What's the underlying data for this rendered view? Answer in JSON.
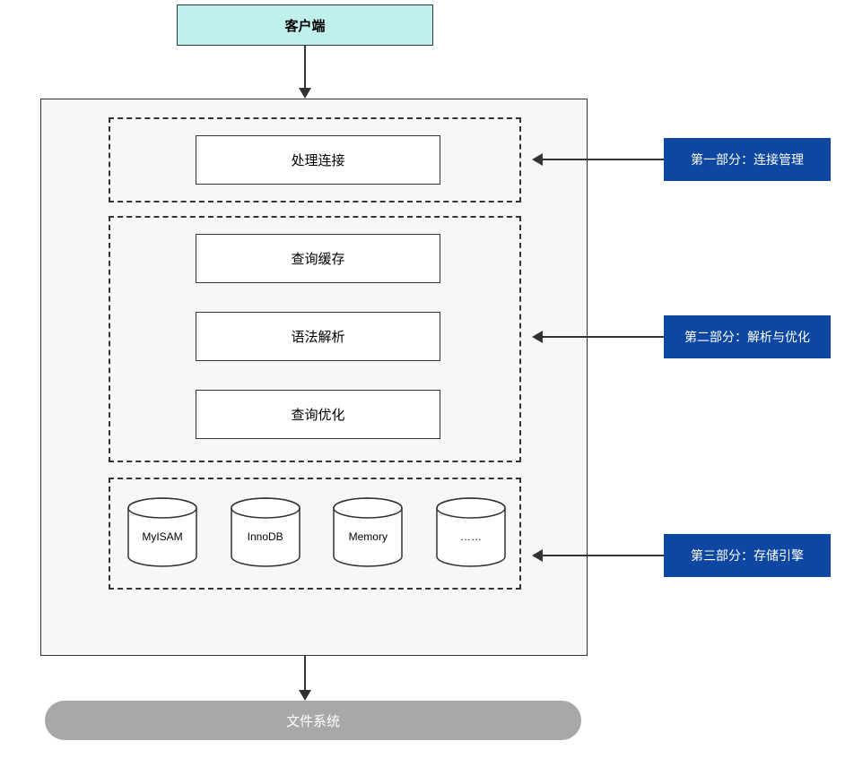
{
  "client": "客户端",
  "section1": {
    "box": "处理连接",
    "annotation": "第一部分：连接管理"
  },
  "section2": {
    "cache": "查询缓存",
    "parse": "语法解析",
    "optimize": "查询优化",
    "annotation": "第二部分：解析与优化"
  },
  "section3": {
    "engines": [
      "MyISAM",
      "InnoDB",
      "Memory",
      "……"
    ],
    "annotation": "第三部分：存储引擎"
  },
  "filesystem": "文件系统"
}
